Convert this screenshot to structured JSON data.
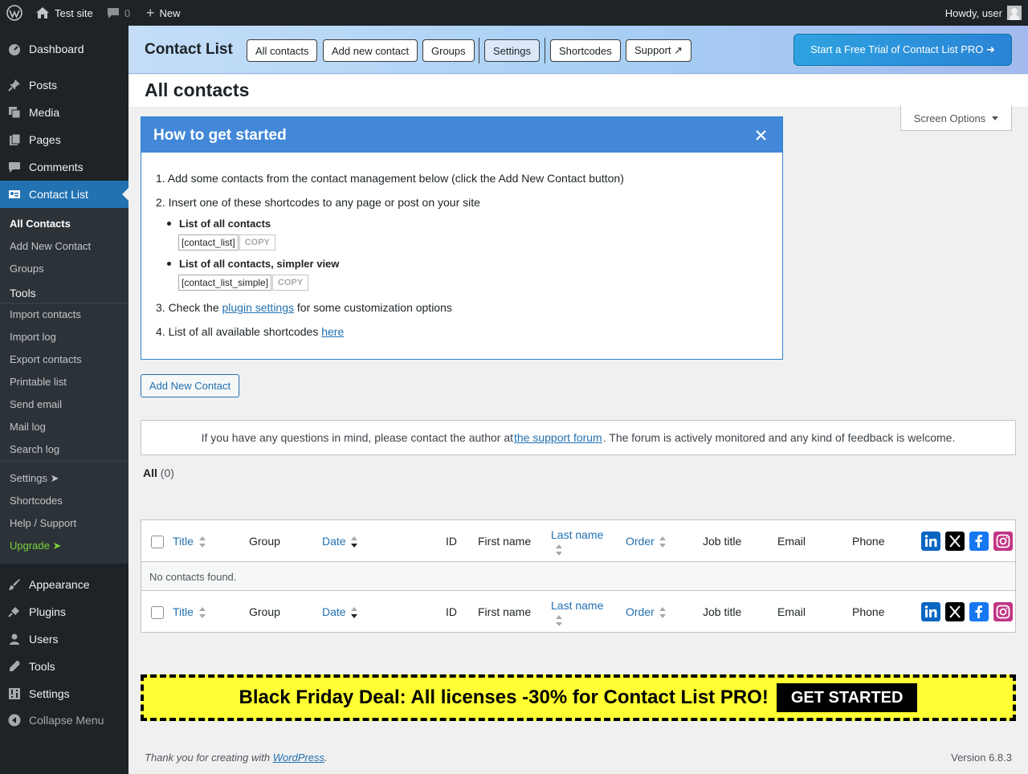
{
  "adminbar": {
    "site_name": "Test site",
    "comments_count": "0",
    "new_label": "New",
    "howdy": "Howdy, user"
  },
  "sidebar": {
    "dashboard": "Dashboard",
    "posts": "Posts",
    "media": "Media",
    "pages": "Pages",
    "comments": "Comments",
    "contact_list": "Contact List",
    "submenu": {
      "all_contacts": "All Contacts",
      "add_new": "Add New Contact",
      "groups": "Groups",
      "tools_heading": "Tools",
      "import_contacts": "Import contacts",
      "import_log": "Import log",
      "export_contacts": "Export contacts",
      "printable_list": "Printable list",
      "send_email": "Send email",
      "mail_log": "Mail log",
      "search_log": "Search log",
      "settings": "Settings ➤",
      "shortcodes": "Shortcodes",
      "help_support": "Help / Support",
      "upgrade": "Upgrade ➤"
    },
    "appearance": "Appearance",
    "plugins": "Plugins",
    "users": "Users",
    "tools": "Tools",
    "settings": "Settings",
    "collapse": "Collapse Menu"
  },
  "plugin_header": {
    "title": "Contact List",
    "nav": [
      "All contacts",
      "Add new contact",
      "Groups",
      "Settings",
      "Shortcodes",
      "Support ↗"
    ],
    "trial": "Start a Free Trial of Contact List PRO ➜"
  },
  "page": {
    "title": "All contacts",
    "screen_options": "Screen Options"
  },
  "info_box": {
    "title": "How to get started",
    "step1": "1. Add some contacts from the contact management below (click the Add New Contact button)",
    "step2": "2. Insert one of these shortcodes to any page or post on your site",
    "sc1_title": "List of all contacts",
    "sc1_code": "[contact_list]",
    "sc2_title": "List of all contacts, simpler view",
    "sc2_code": "[contact_list_simple]",
    "copy": "COPY",
    "step3_pre": "3. Check the ",
    "step3_link": "plugin settings",
    "step3_post": " for some customization options",
    "step4_pre": "4. List of all available shortcodes ",
    "step4_link": "here"
  },
  "add_new_button": "Add New Contact",
  "support_notice": {
    "pre": "If you have any questions in mind, please contact the author at ",
    "link": "the support forum",
    "post": ". The forum is actively monitored and any kind of feedback is welcome."
  },
  "filter": {
    "all": "All",
    "count": "(0)"
  },
  "table": {
    "columns": [
      "Title",
      "Group",
      "Date",
      "ID",
      "First name",
      "Last name",
      "Order",
      "Job title",
      "Email",
      "Phone"
    ],
    "empty": "No contacts found."
  },
  "banner": {
    "text": "Black Friday Deal: All licenses -30% for Contact List PRO!",
    "button": "GET STARTED"
  },
  "footer": {
    "thanks_pre": "Thank you for creating with ",
    "thanks_link": "WordPress",
    "thanks_post": ".",
    "version": "Version 6.8.3"
  },
  "colors": {
    "accent": "#2271b1",
    "sidebar_bg": "#1d2327",
    "info_header": "#4287d8",
    "banner_bg": "#ffff33",
    "upgrade": "#7ad03a"
  }
}
